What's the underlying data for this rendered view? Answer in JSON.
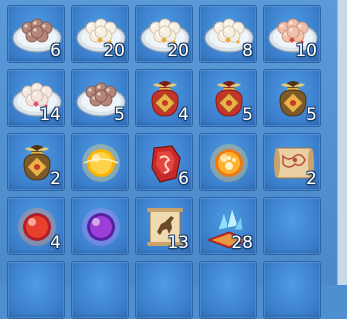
{
  "inventory": {
    "slots": [
      {
        "icon": "plate-of-brown-dumplings-icon",
        "count": "6"
      },
      {
        "icon": "plate-of-white-dumplings-icon",
        "count": "20"
      },
      {
        "icon": "plate-of-white-dumplings-icon",
        "count": "20"
      },
      {
        "icon": "plate-of-white-dumplings-icon",
        "count": "8"
      },
      {
        "icon": "plate-of-pink-dumplings-icon",
        "count": "10"
      },
      {
        "icon": "plate-of-rose-dumplings-icon",
        "count": "14"
      },
      {
        "icon": "plate-of-brown-dumplings-icon",
        "count": "5"
      },
      {
        "icon": "red-lucky-bag-icon",
        "count": "4"
      },
      {
        "icon": "red-lucky-bag-icon",
        "count": "5"
      },
      {
        "icon": "gold-lucky-bag-icon",
        "count": "5"
      },
      {
        "icon": "gold-lucky-bag-icon",
        "count": "2"
      },
      {
        "icon": "golden-glowing-orb-icon",
        "count": ""
      },
      {
        "icon": "red-rune-stone-icon",
        "count": "6"
      },
      {
        "icon": "golden-paw-orb-icon",
        "count": ""
      },
      {
        "icon": "map-scroll-icon",
        "count": "2"
      },
      {
        "icon": "red-glowing-orb-icon",
        "count": "4"
      },
      {
        "icon": "purple-glowing-orb-icon",
        "count": ""
      },
      {
        "icon": "horse-scroll-icon",
        "count": "13"
      },
      {
        "icon": "blue-crystal-on-cushion-icon",
        "count": "28"
      },
      {
        "icon": "",
        "count": ""
      },
      {
        "icon": "",
        "count": ""
      },
      {
        "icon": "",
        "count": ""
      },
      {
        "icon": "",
        "count": ""
      },
      {
        "icon": "",
        "count": ""
      },
      {
        "icon": "",
        "count": ""
      }
    ]
  }
}
